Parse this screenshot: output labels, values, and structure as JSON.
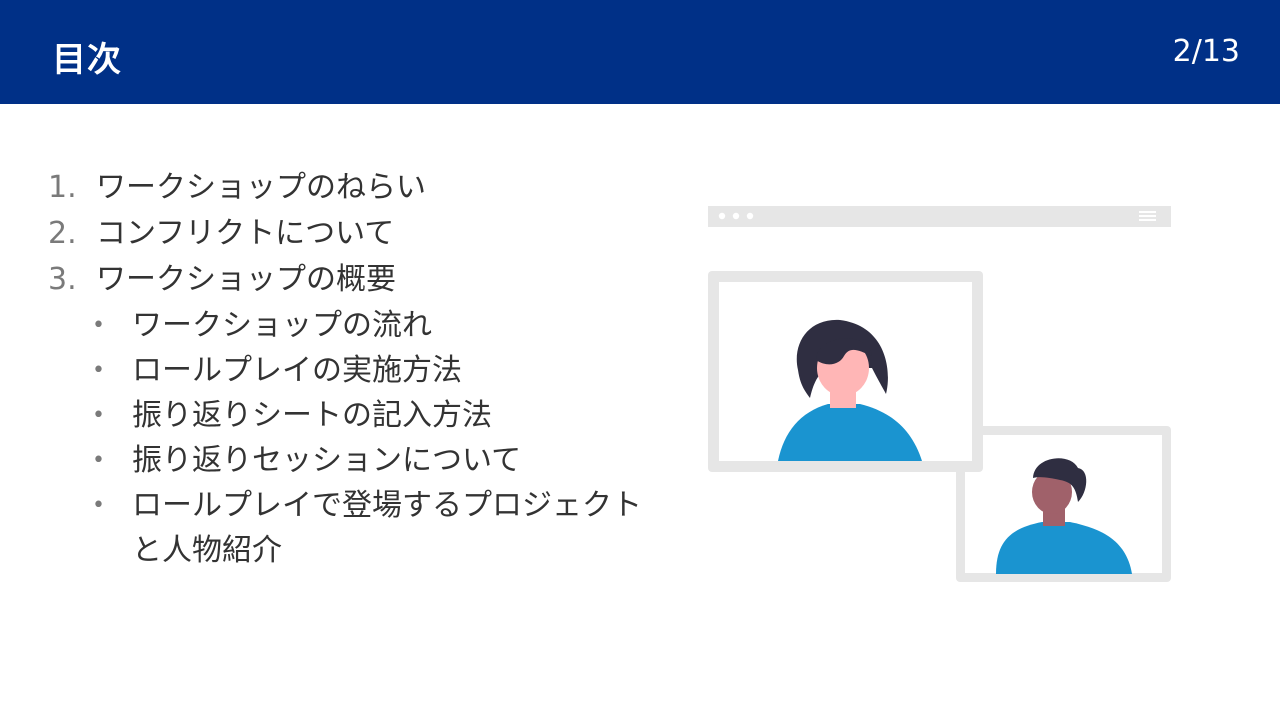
{
  "header": {
    "title": "目次",
    "page_number": "2/13"
  },
  "agenda": {
    "items": [
      {
        "number": "1.",
        "label": "ワークショップのねらい"
      },
      {
        "number": "2.",
        "label": "コンフリクトについて"
      },
      {
        "number": "3.",
        "label": "ワークショップの概要"
      }
    ],
    "bullet": "•",
    "sub_items": [
      "ワークショップの流れ",
      "ロールプレイの実施方法",
      "振り返りシートの記入方法",
      "振り返りセッションについて",
      "ロールプレイで登場するプロジェクトと人物紹介"
    ]
  },
  "colors": {
    "header_bg": "#003087",
    "shirt": "#1a94d0",
    "hair": "#2f2e41",
    "skin_light": "#ffb6b6",
    "skin_dark": "#a0616a",
    "frame": "#e6e6e6"
  },
  "illustration": {
    "icon": "video-call-illustration"
  }
}
